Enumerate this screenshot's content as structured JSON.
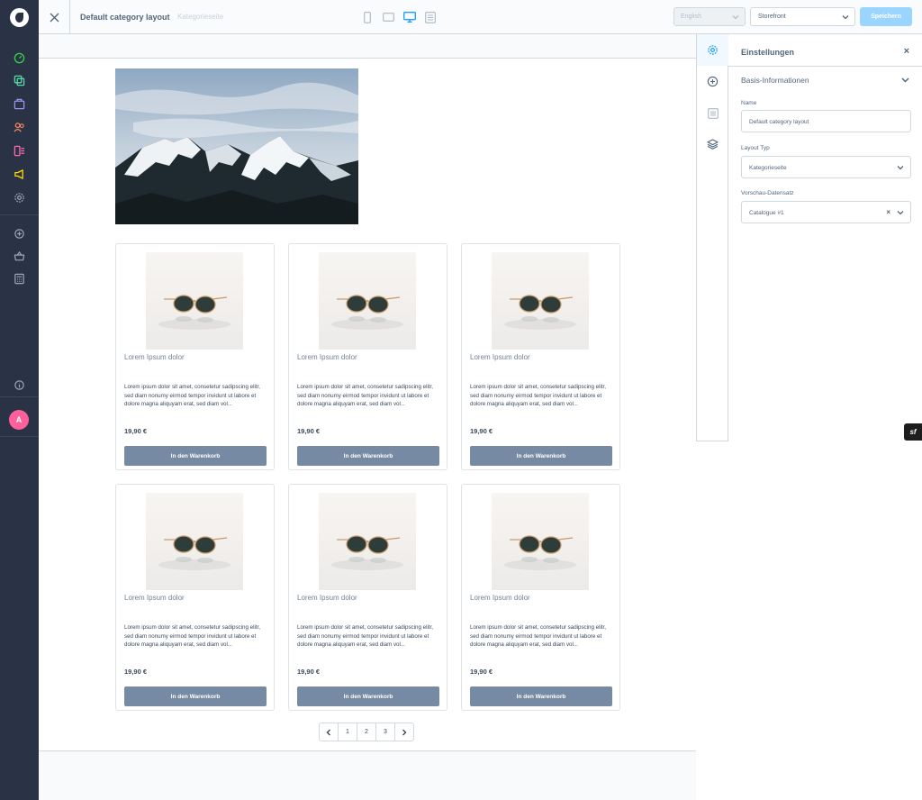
{
  "header": {
    "title": "Default category layout",
    "subtitle": "Kategorieseite",
    "language_select": "English",
    "sales_channel_select": "Storefront",
    "save_label": "Speichern",
    "active_device": "desktop"
  },
  "sidebar": {
    "avatar_letter": "A",
    "icons": [
      "dashboard-icon",
      "catalogue-icon",
      "orders-icon",
      "customers-icon",
      "content-icon",
      "marketing-icon",
      "settings-icon",
      "extensions-icon",
      "sales-channel-basket-icon",
      "calculator-icon",
      "info-icon"
    ]
  },
  "products": [
    {
      "name": "Lorem Ipsum dolor",
      "description": "Lorem ipsum dolor sit amet, consetetur sadipscing elitr, sed diam nonumy eirmod tempor invidunt ut labore et dolore magna aliquyam erat, sed diam vol...",
      "price": "19,90 €",
      "button": "In den Warenkorb"
    },
    {
      "name": "Lorem Ipsum dolor",
      "description": "Lorem ipsum dolor sit amet, consetetur sadipscing elitr, sed diam nonumy eirmod tempor invidunt ut labore et dolore magna aliquyam erat, sed diam vol...",
      "price": "19,90 €",
      "button": "In den Warenkorb"
    },
    {
      "name": "Lorem Ipsum dolor",
      "description": "Lorem ipsum dolor sit amet, consetetur sadipscing elitr, sed diam nonumy eirmod tempor invidunt ut labore et dolore magna aliquyam erat, sed diam vol...",
      "price": "19,90 €",
      "button": "In den Warenkorb"
    },
    {
      "name": "Lorem Ipsum dolor",
      "description": "Lorem ipsum dolor sit amet, consetetur sadipscing elitr, sed diam nonumy eirmod tempor invidunt ut labore et dolore magna aliquyam erat, sed diam vol...",
      "price": "19,90 €",
      "button": "In den Warenkorb"
    },
    {
      "name": "Lorem Ipsum dolor",
      "description": "Lorem ipsum dolor sit amet, consetetur sadipscing elitr, sed diam nonumy eirmod tempor invidunt ut labore et dolore magna aliquyam erat, sed diam vol...",
      "price": "19,90 €",
      "button": "In den Warenkorb"
    },
    {
      "name": "Lorem Ipsum dolor",
      "description": "Lorem ipsum dolor sit amet, consetetur sadipscing elitr, sed diam nonumy eirmod tempor invidunt ut labore et dolore magna aliquyam erat, sed diam vol...",
      "price": "19,90 €",
      "button": "In den Warenkorb"
    }
  ],
  "pagination": {
    "prev": "‹",
    "pages": [
      "1",
      "2",
      "3"
    ],
    "next": "›"
  },
  "panel": {
    "title": "Einstellungen",
    "close": "×",
    "section_title": "Basis-Informationen",
    "name_label": "Name",
    "name_value": "Default category layout",
    "type_label": "Layout Typ",
    "type_value": "Kategorieseite",
    "preview_label": "Vorschau-Datensatz",
    "preview_value": "Catalogue #1",
    "preview_clear": "×"
  },
  "colors": {
    "accent": "#189eff",
    "sidebar_bg": "#2a3345",
    "button_bg": "#768ba3",
    "save_button_bg": "#9ad5ff",
    "avatar_bg": "#ff5f9b"
  }
}
